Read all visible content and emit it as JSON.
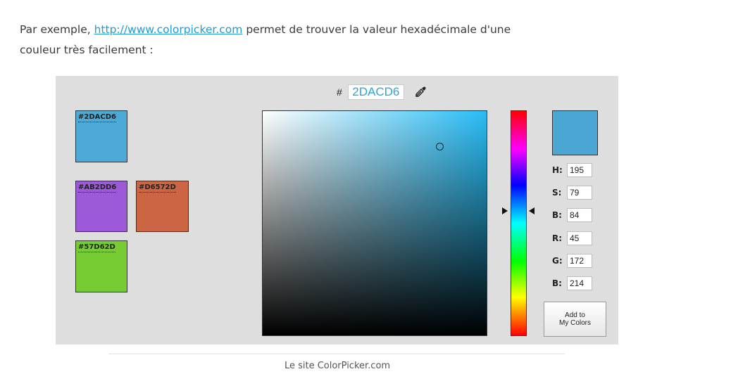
{
  "paragraph": {
    "prefix": "Par exemple, ",
    "link": "http://www.colorpicker.com",
    "line1_suffix": " permet de trouver la valeur hexadécimale d'une",
    "line2": "couleur très facilement :"
  },
  "picker": {
    "hash_label": "#",
    "hex_value": "2DACD6",
    "swatches": [
      {
        "label": "#2DACD6",
        "color": "#4daad6"
      },
      {
        "label": "#AB2DD6",
        "color": "#9d59d8"
      },
      {
        "label": "#D6572D",
        "color": "#cb6543"
      },
      {
        "label": "#57D62D",
        "color": "#78cc33"
      }
    ],
    "current_color": "#4aa7d3",
    "fields": [
      {
        "label": "H:",
        "value": "195"
      },
      {
        "label": "S:",
        "value": "79"
      },
      {
        "label": "B:",
        "value": "84"
      },
      {
        "label": "R:",
        "value": "45"
      },
      {
        "label": "G:",
        "value": "172"
      },
      {
        "label": "B:",
        "value": "214"
      }
    ],
    "add_button_line1": "Add to",
    "add_button_line2": "My Colors"
  },
  "caption": "Le site ColorPicker.com"
}
